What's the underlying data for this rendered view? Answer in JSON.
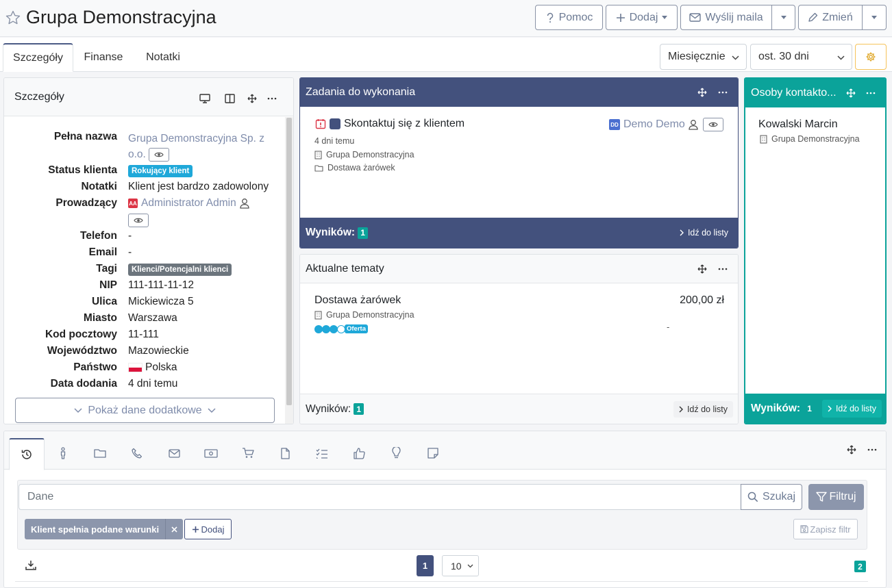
{
  "header": {
    "title": "Grupa Demonstracyjna",
    "help_label": "Pomoc",
    "add_label": "Dodaj",
    "send_mail_label": "Wyślij maila",
    "edit_label": "Zmień"
  },
  "tabs": [
    {
      "label": "Szczegóły",
      "active": true
    },
    {
      "label": "Finanse",
      "active": false
    },
    {
      "label": "Notatki",
      "active": false
    }
  ],
  "filters": {
    "period": "Miesięcznie",
    "range": "ost. 30 dni"
  },
  "details": {
    "title": "Szczegóły",
    "fields": [
      {
        "label": "Pełna nazwa",
        "value": "Grupa Demonstracyjna Sp. z o.o."
      },
      {
        "label": "Status klienta",
        "value": "Rokujący klient"
      },
      {
        "label": "Notatki",
        "value": "Klient jest bardzo zadowolony"
      },
      {
        "label": "Prowadzący",
        "value": "Administrator Admin",
        "initials": "AA"
      },
      {
        "label": "Telefon",
        "value": "-"
      },
      {
        "label": "Email",
        "value": "-"
      },
      {
        "label": "Tagi",
        "value": "Klienci/Potencjalni klienci"
      },
      {
        "label": "NIP",
        "value": "111-111-11-12"
      },
      {
        "label": "Ulica",
        "value": "Mickiewicza 5"
      },
      {
        "label": "Miasto",
        "value": "Warszawa"
      },
      {
        "label": "Kod pocztowy",
        "value": "11-111"
      },
      {
        "label": "Województwo",
        "value": "Mazowieckie"
      },
      {
        "label": "Państwo",
        "value": "Polska"
      },
      {
        "label": "Data dodania",
        "value": "4 dni temu"
      }
    ],
    "show_more_label": "Pokaż dane dodatkowe"
  },
  "tasks": {
    "title": "Zadania do wykonania",
    "item": {
      "name": "Skontaktuj się z klientem",
      "time": "4 dni temu",
      "company": "Grupa Demonstracyjna",
      "topic": "Dostawa żarówek",
      "owner": "Demo Demo",
      "owner_initials": "DD"
    },
    "results_label": "Wyników:",
    "results_count": "1",
    "go_to_list": "Idź do listy"
  },
  "topics": {
    "title": "Aktualne tematy",
    "item": {
      "name": "Dostawa żarówek",
      "amount": "200,00 zł",
      "company": "Grupa Demonstracyjna",
      "stage": "Oferta",
      "dash": "-",
      "progress_filled": 3,
      "progress_total": 4
    },
    "results_label": "Wyników:",
    "results_count": "1",
    "go_to_list": "Idź do listy"
  },
  "contacts": {
    "title": "Osoby kontakto...",
    "item": {
      "name": "Kowalski Marcin",
      "company": "Grupa Demonstracyjna"
    },
    "results_label": "Wyników:",
    "results_count": "1",
    "go_to_list": "Idź do listy"
  },
  "history": {
    "search_placeholder": "Dane",
    "search_label": "Szukaj",
    "filter_label": "Filtruj",
    "condition_label": "Klient spełnia podane warunki",
    "add_label": "Dodaj",
    "save_filter_label": "Zapisz filtr",
    "page": "1",
    "per_page": "10",
    "total": "2"
  },
  "colors": {
    "navy": "#43517d",
    "teal": "#0ba39a",
    "accent_blue": "#1fa8d9",
    "gray_badge": "#6c757d",
    "gear_border": "#f5c35a"
  }
}
